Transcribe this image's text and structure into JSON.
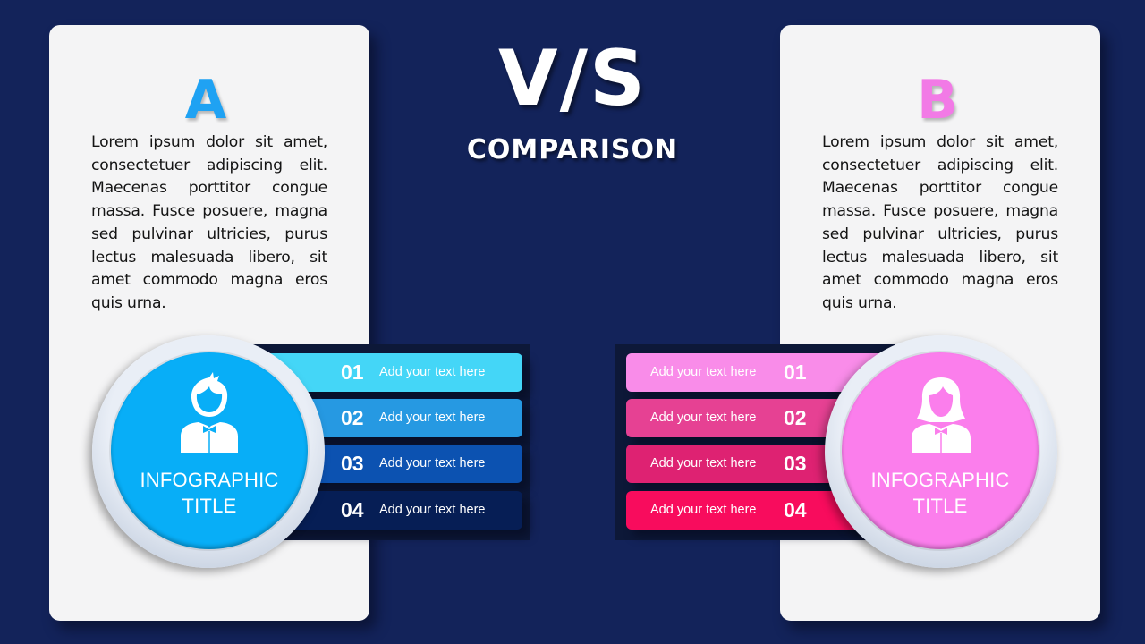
{
  "center": {
    "title": "V/S",
    "subtitle": "COMPARISON"
  },
  "panels": [
    {
      "letter": "A",
      "letter_color": "#1fa2f3",
      "paragraph": "Lorem ipsum dolor sit amet, consectetuer adipiscing elit. Maecenas porttitor congue massa. Fusce posuere, magna sed pulvinar ultricies, purus lectus malesuada libero, sit amet commodo magna eros quis urna.",
      "circle": {
        "icon": "man-icon",
        "title_line1": "INFOGRAPHIC",
        "title_line2": "TITLE",
        "color": "#08aef7"
      },
      "items": [
        {
          "number": "01",
          "text": "Add your text here",
          "color": "#44d6f7"
        },
        {
          "number": "02",
          "text": "Add your text here",
          "color": "#2699e2"
        },
        {
          "number": "03",
          "text": "Add your text here",
          "color": "#0c52b1"
        },
        {
          "number": "04",
          "text": "Add your text here",
          "color": "#061e55"
        }
      ]
    },
    {
      "letter": "B",
      "letter_color": "#f27ae6",
      "paragraph": "Lorem ipsum dolor sit amet, consectetuer adipiscing elit. Maecenas porttitor congue massa. Fusce posuere, magna sed pulvinar ultricies, purus lectus malesuada libero, sit amet commodo magna eros quis urna.",
      "circle": {
        "icon": "woman-icon",
        "title_line1": "INFOGRAPHIC",
        "title_line2": "TITLE",
        "color": "#fb7eec"
      },
      "items": [
        {
          "number": "01",
          "text": "Add your text here",
          "color": "#f98ce9"
        },
        {
          "number": "02",
          "text": "Add your text here",
          "color": "#e64193"
        },
        {
          "number": "03",
          "text": "Add your text here",
          "color": "#de2272"
        },
        {
          "number": "04",
          "text": "Add your text here",
          "color": "#f80c5d"
        }
      ]
    }
  ]
}
